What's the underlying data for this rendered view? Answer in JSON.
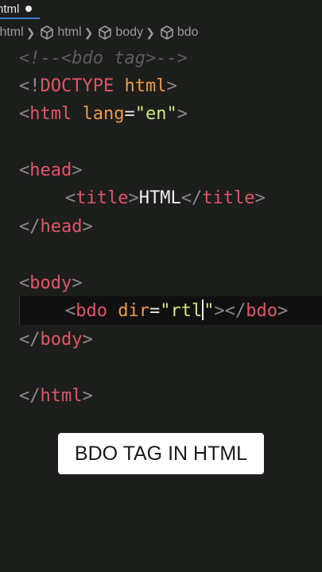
{
  "tab": {
    "label": "html"
  },
  "breadcrumb": {
    "items": [
      ".html",
      "html",
      "body",
      "bdo"
    ]
  },
  "code": {
    "line1": {
      "comment": "<!--<bdo tag>-->"
    },
    "line2": {
      "open": "<!",
      "doctype": "DOCTYPE",
      "space": " ",
      "html": "html",
      "close": ">"
    },
    "line3": {
      "open": "<",
      "tag": "html",
      "attr": "lang",
      "eq": "=",
      "value": "\"en\"",
      "close": ">"
    },
    "line5": {
      "open": "<",
      "tag": "head",
      "close": ">"
    },
    "line6": {
      "open": "<",
      "tag": "title",
      "close": ">",
      "text": "HTML",
      "open2": "</",
      "tag2": "title",
      "close2": ">"
    },
    "line7": {
      "open": "</",
      "tag": "head",
      "close": ">"
    },
    "line9": {
      "open": "<",
      "tag": "body",
      "close": ">"
    },
    "line10": {
      "open": "<",
      "tag": "bdo",
      "attr": "dir",
      "eq": "=",
      "q1": "\"",
      "value": "rtl",
      "q2": "\"",
      "close": ">",
      "open2": "</",
      "tag2": "bdo",
      "close2": ">"
    },
    "line11": {
      "open": "</",
      "tag": "body",
      "close": ">"
    },
    "line13": {
      "open": "</",
      "tag": "html",
      "close": ">"
    }
  },
  "caption": {
    "text": "BDO TAG IN HTML"
  },
  "colors": {
    "background": "#1c1e1b",
    "tag": "#e2556b",
    "attribute": "#f29a4a",
    "string": "#cfe87a",
    "comment": "#5d5d5d"
  }
}
